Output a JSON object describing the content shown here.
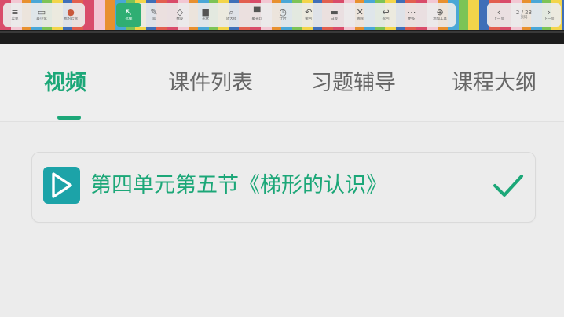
{
  "toolbar": {
    "left_items": [
      {
        "icon": "menu-icon",
        "label": "菜单"
      },
      {
        "icon": "mini-window-icon",
        "label": "最小化"
      },
      {
        "icon": "avatar-icon",
        "label": "我的云盘"
      }
    ],
    "tools": [
      {
        "icon": "cursor-icon",
        "label": "选择"
      },
      {
        "icon": "pen-icon",
        "label": "笔"
      },
      {
        "icon": "eraser-icon",
        "label": "橡皮"
      },
      {
        "icon": "shape-icon",
        "label": "形状"
      },
      {
        "icon": "magnifier-icon",
        "label": "放大镜"
      },
      {
        "icon": "spotlight-icon",
        "label": "聚光灯"
      },
      {
        "icon": "timer-icon",
        "label": "计时"
      },
      {
        "icon": "undo-icon",
        "label": "撤回"
      },
      {
        "icon": "blackboard-icon",
        "label": "白板"
      },
      {
        "icon": "clear-icon",
        "label": "清除"
      },
      {
        "icon": "return-icon",
        "label": "返回"
      },
      {
        "icon": "more-icon",
        "label": "更多"
      },
      {
        "icon": "tools-icon",
        "label": "添加工具"
      }
    ],
    "pager": {
      "prev_label": "上一页",
      "pages": "2 / 23",
      "page_label": "页码",
      "next_label": "下一页"
    }
  },
  "tabs": [
    {
      "label": "视频",
      "active": true
    },
    {
      "label": "课件列表",
      "active": false
    },
    {
      "label": "习题辅导",
      "active": false
    },
    {
      "label": "课程大纲",
      "active": false
    }
  ],
  "lesson": {
    "title": "第四单元第五节《梯形的认识》",
    "status_icon": "checkmark-icon",
    "accent_color": "#1ca778",
    "play_color": "#1ca3a8"
  }
}
